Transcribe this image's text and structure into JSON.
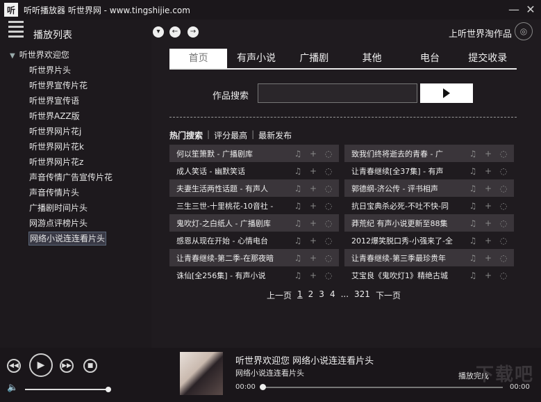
{
  "app": {
    "logo_text": "听",
    "title": "听听播放器 听世界网 - www.tingshijie.com"
  },
  "window": {
    "minimize": "—",
    "close": "✕"
  },
  "sidebar": {
    "title": "播放列表",
    "root_label": "听世界欢迎您",
    "items": [
      "听世界片头",
      "听世界宣传片花",
      "听世界宣传语",
      "听世界AZZ版",
      "听世界网片花j",
      "听世界网片花k",
      "听世界网片花z",
      "声音传情广告宣传片花",
      "声音传情片头",
      "广播剧时间片头",
      "网游点评榜片头",
      "网络小说连连看片头"
    ],
    "selected_index": 11
  },
  "topnav": {
    "shop_label": "上听世界淘作品"
  },
  "tabs": [
    "首页",
    "有声小说",
    "广播剧",
    "其他",
    "电台",
    "提交收录"
  ],
  "active_tab": 0,
  "search": {
    "label": "作品搜索",
    "value": ""
  },
  "filters": {
    "hot": "热门搜索",
    "sep": "|",
    "top": "评分最高",
    "new": "最新发布"
  },
  "left_list": [
    "何以笙箫默 - 广播剧库",
    "成人笑话 - 幽默笑话",
    "夫妻生活两性话题 - 有声人",
    "三生三世-十里桃花-10音社 -",
    "鬼吹灯-之白纸人 - 广播剧库",
    "感恩从现在开始 - 心情电台",
    "让青春继续-第二季-在那夜暗",
    "诛仙[全256集] - 有声小说"
  ],
  "right_list": [
    "致我们终将逝去的青春 - 广",
    "让青春继续[全37集] - 有声",
    "郭德纲-济公传 - 评书相声",
    "抗日宝典杀必死-不吐不快-同",
    "莽荒纪 有声小说更新至88集",
    "2012爆笑脱口秀-小强来了-全",
    "让青春继续-第三季最珍贵年",
    "艾宝良《鬼吹灯1》精绝古城"
  ],
  "pager": {
    "prev": "上一页",
    "pages": [
      "1",
      "2",
      "3",
      "4"
    ],
    "ellipsis": "...",
    "last": "321",
    "next": "下一页",
    "current": "1"
  },
  "player": {
    "now_title": "听世界欢迎您  网络小说连连看片头",
    "now_sub": "网络小说连连看片头",
    "status": "播放完成",
    "time_start": "00:00",
    "time_end": "00:00",
    "volume": 1.0,
    "progress": 0.0
  },
  "watermark": "下载吧",
  "colors": {
    "bg": "#1f1b1f",
    "accent": "#ffffff",
    "row_shade": "#3a353a"
  }
}
